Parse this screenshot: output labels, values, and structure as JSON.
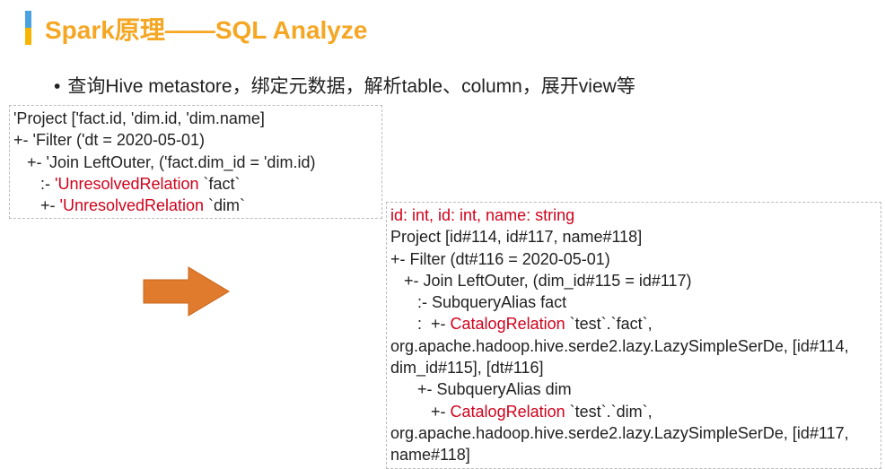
{
  "title": "Spark原理——SQL Analyze",
  "bullet": "查询Hive metastore，绑定元数据，解析table、column，展开view等",
  "unresolved": {
    "l1": "'Project ['fact.id, 'dim.id, 'dim.name]",
    "l2": "+- 'Filter ('dt = 2020-05-01)",
    "l3": "   +- 'Join LeftOuter, ('fact.dim_id = 'dim.id)",
    "l4p": "      :- ",
    "l4r": "'UnresolvedRelation",
    "l4s": " `fact`",
    "l5p": "      +- ",
    "l5r": "'UnresolvedRelation",
    "l5s": " `dim`"
  },
  "resolved": {
    "schema": "id: int, id: int, name: string",
    "l2": "Project [id#114, id#117, name#118]",
    "l3": "+- Filter (dt#116 = 2020-05-01)",
    "l4": "   +- Join LeftOuter, (dim_id#115 = id#117)",
    "l5": "      :- SubqueryAlias fact",
    "l6p": "      :  +- ",
    "l6r": "CatalogRelation",
    "l6s": " `test`.`fact`, org.apache.hadoop.hive.serde2.lazy.LazySimpleSerDe, [id#114, dim_id#115], [dt#116]",
    "l7": "      +- SubqueryAlias dim",
    "l8p": "         +- ",
    "l8r": "CatalogRelation",
    "l8s": " `test`.`dim`, org.apache.hadoop.hive.serde2.lazy.LazySimpleSerDe, [id#117, name#118]"
  }
}
